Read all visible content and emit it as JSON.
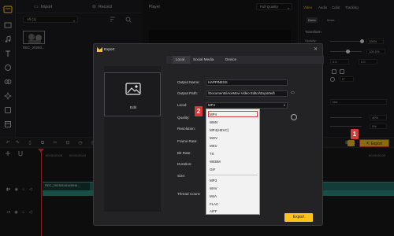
{
  "colors": {
    "accent": "#ffc21a",
    "badge": "#d83a3a",
    "selection": "#e23b3b"
  },
  "media": {
    "import_label": "Import",
    "record_label": "Record",
    "filter_value": "All (1)",
    "clip_name": "REC_20260..."
  },
  "player": {
    "title": "Player",
    "quality": "Full Quality"
  },
  "props": {
    "tabs": [
      "Video",
      "Audio",
      "Color",
      "Tracking"
    ],
    "subtabs": [
      "Basic",
      "Mask"
    ],
    "section": "Transform",
    "opacity_label": "Opacity:",
    "opacity_value": "100%",
    "scale_value": "100.0%",
    "pos_x": "0.0",
    "pos_y": "0.0",
    "rotate_value": "0°",
    "blend_value": "Nor...",
    "pct_a": "40%",
    "pct_b": "0%"
  },
  "timeline": {
    "clip_label": "REC_20230116165944...",
    "ts1": "00:00:00:00",
    "ts2": "00:00:00:10",
    "ts3": "00:00:00:20",
    "ts4": "00:00:00:00"
  },
  "dialog": {
    "title": "Export",
    "tabs": [
      "Local",
      "Social Media",
      "Device"
    ],
    "edit_label": "Edit",
    "output_name_label": "Output Name:",
    "output_name_value": "HAPPINESS",
    "output_path_label": "Output Path:",
    "output_path_value": "\\Documents\\AceMovi Video Editor\\Exported\\",
    "local_label": "Local:",
    "local_value": "MP4",
    "quality_label": "Quality:",
    "resolution_label": "Resolution:",
    "frame_rate_label": "Frame Rate:",
    "bit_rate_label": "Bit Rate:",
    "duration_label": "Duration:",
    "size_label": "Size:",
    "thread_count_label": "Thread Count:",
    "export_button": "Export"
  },
  "dropdown": {
    "options": [
      "MP4",
      "WMV",
      "MP4(HEVC)",
      "MOV",
      "MKV",
      "TS",
      "WEBM",
      "GIF",
      "MP3",
      "WAV",
      "M4A",
      "FLAC",
      "AIFF"
    ],
    "selected": "MP4"
  },
  "toolbar_export_button": "Export",
  "annotations": {
    "step1": "1",
    "step2": "2"
  }
}
